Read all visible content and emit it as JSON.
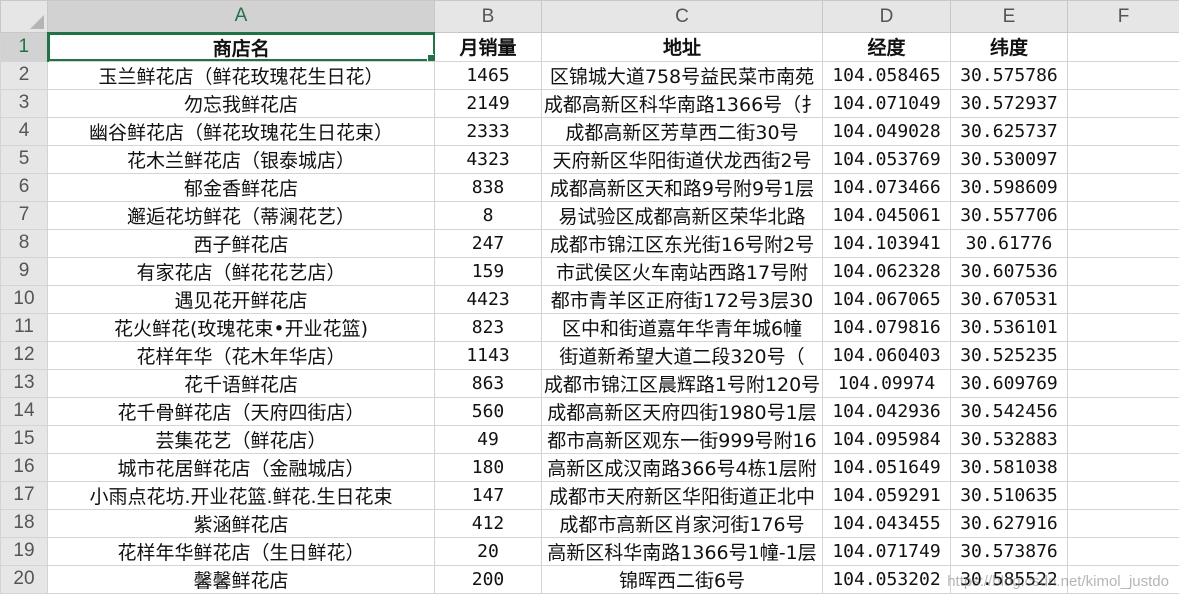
{
  "columns": [
    "A",
    "B",
    "C",
    "D",
    "E",
    "F"
  ],
  "active_column": "A",
  "active_row": "1",
  "header": {
    "row_number": "1",
    "shop_name": "商店名",
    "monthly_sales": "月销量",
    "address": "地址",
    "longitude": "经度",
    "latitude": "纬度"
  },
  "rows": [
    {
      "num": "2",
      "name": "玉兰鲜花店（鲜花玫瑰花生日花）",
      "sales": "1465",
      "address": "区锦城大道758号益民菜市南苑",
      "lng": "104.058465",
      "lat": "30.575786"
    },
    {
      "num": "3",
      "name": "勿忘我鲜花店",
      "sales": "2149",
      "address": "成都高新区科华南路1366号（扌",
      "lng": "104.071049",
      "lat": "30.572937"
    },
    {
      "num": "4",
      "name": "幽谷鲜花店（鲜花玫瑰花生日花束）",
      "sales": "2333",
      "address": "成都高新区芳草西二街30号",
      "lng": "104.049028",
      "lat": "30.625737"
    },
    {
      "num": "5",
      "name": "花木兰鲜花店（银泰城店）",
      "sales": "4323",
      "address": "天府新区华阳街道伏龙西街2号",
      "lng": "104.053769",
      "lat": "30.530097"
    },
    {
      "num": "6",
      "name": "郁金香鲜花店",
      "sales": "838",
      "address": "成都高新区天和路9号附9号1层",
      "lng": "104.073466",
      "lat": "30.598609"
    },
    {
      "num": "7",
      "name": "邂逅花坊鲜花（蒂澜花艺）",
      "sales": "8",
      "address": "易试验区成都高新区荣华北路",
      "lng": "104.045061",
      "lat": "30.557706"
    },
    {
      "num": "8",
      "name": "西子鲜花店",
      "sales": "247",
      "address": "成都市锦江区东光街16号附2号",
      "lng": "104.103941",
      "lat": "30.61776"
    },
    {
      "num": "9",
      "name": "有家花店（鲜花花艺店）",
      "sales": "159",
      "address": "市武侯区火车南站西路17号附",
      "lng": "104.062328",
      "lat": "30.607536"
    },
    {
      "num": "10",
      "name": "遇见花开鲜花店",
      "sales": "4423",
      "address": "都市青羊区正府街172号3层30",
      "lng": "104.067065",
      "lat": "30.670531"
    },
    {
      "num": "11",
      "name": "花火鲜花(玫瑰花束•开业花篮)",
      "sales": "823",
      "address": "区中和街道嘉年华青年城6幢",
      "lng": "104.079816",
      "lat": "30.536101"
    },
    {
      "num": "12",
      "name": "花样年华（花木年华店）",
      "sales": "1143",
      "address": "街道新希望大道二段320号（",
      "lng": "104.060403",
      "lat": "30.525235"
    },
    {
      "num": "13",
      "name": "花千语鲜花店",
      "sales": "863",
      "address": "成都市锦江区晨辉路1号附120号",
      "lng": "104.09974",
      "lat": "30.609769"
    },
    {
      "num": "14",
      "name": "花千骨鲜花店（天府四街店）",
      "sales": "560",
      "address": "成都高新区天府四街1980号1层",
      "lng": "104.042936",
      "lat": "30.542456"
    },
    {
      "num": "15",
      "name": "芸集花艺（鲜花店）",
      "sales": "49",
      "address": "都市高新区观东一街999号附16",
      "lng": "104.095984",
      "lat": "30.532883"
    },
    {
      "num": "16",
      "name": "城市花居鲜花店（金融城店）",
      "sales": "180",
      "address": "高新区成汉南路366号4栋1层附",
      "lng": "104.051649",
      "lat": "30.581038"
    },
    {
      "num": "17",
      "name": "小雨点花坊.开业花篮.鲜花.生日花束",
      "sales": "147",
      "address": "成都市天府新区华阳街道正北中",
      "lng": "104.059291",
      "lat": "30.510635"
    },
    {
      "num": "18",
      "name": "紫涵鲜花店",
      "sales": "412",
      "address": "成都市高新区肖家河街176号",
      "lng": "104.043455",
      "lat": "30.627916"
    },
    {
      "num": "19",
      "name": "花样年华鲜花店（生日鲜花）",
      "sales": "20",
      "address": "高新区科华南路1366号1幢-1层",
      "lng": "104.071749",
      "lat": "30.573876"
    },
    {
      "num": "20",
      "name": "馨馨鲜花店",
      "sales": "200",
      "address": "锦晖西二街6号",
      "lng": "104.053202",
      "lat": "30.585522"
    }
  ],
  "watermark": "https://blog.csdn.net/kimol_justdo",
  "colors": {
    "accent": "#217346",
    "header_bg": "#e6e6e6",
    "grid": "#d4d4d4"
  }
}
